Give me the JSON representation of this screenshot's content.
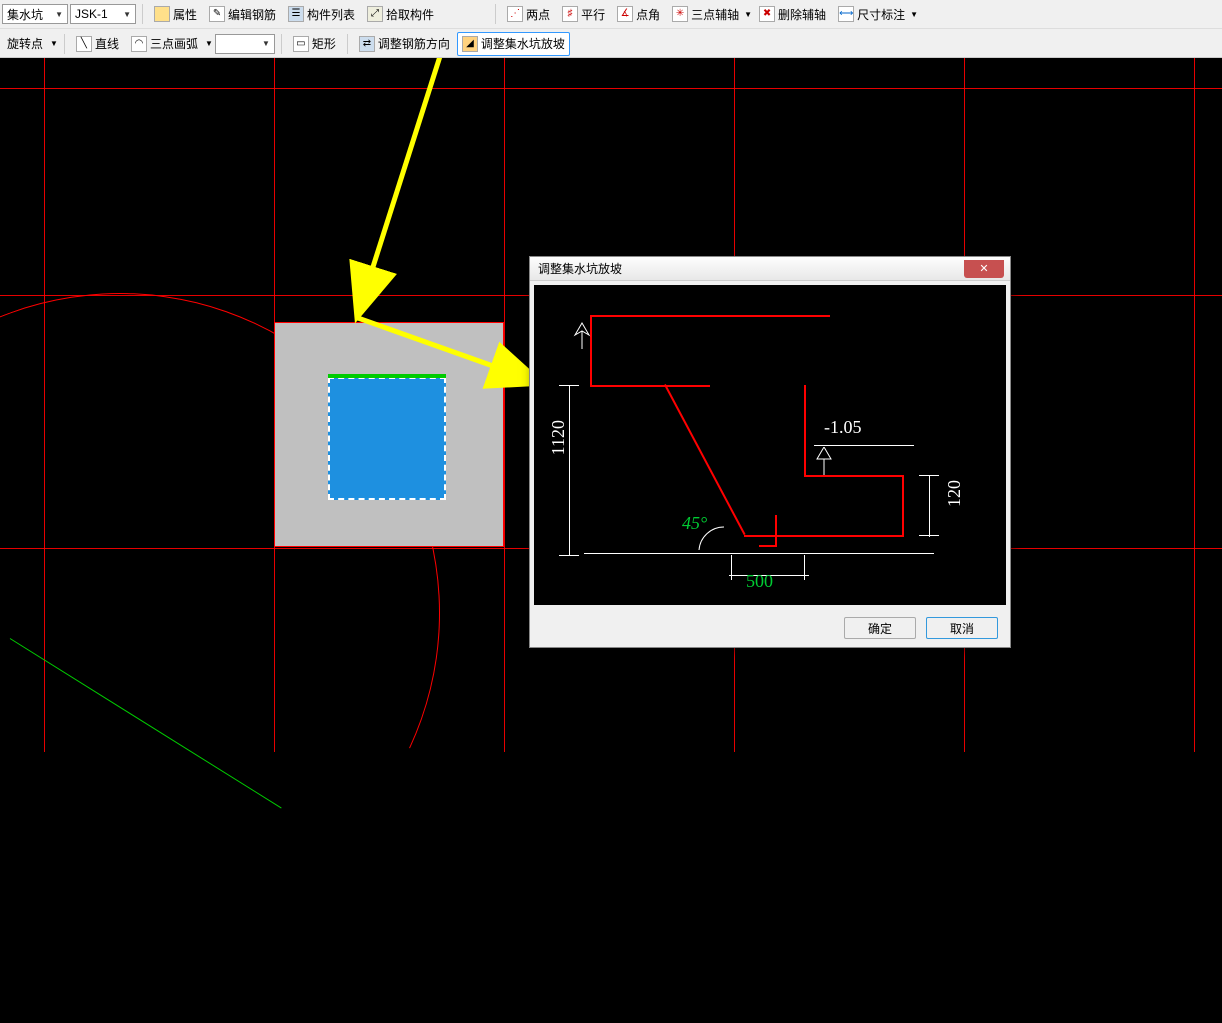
{
  "toolbar": {
    "dropdown1": "集水坑",
    "dropdown2": "JSK-1",
    "attributes": "属性",
    "edit_rebar": "编辑钢筋",
    "component_list": "构件列表",
    "pick_component": "拾取构件",
    "two_point": "两点",
    "parallel": "平行",
    "point_angle": "点角",
    "three_point_axis": "三点辅轴",
    "delete_axis": "删除辅轴",
    "dimension": "尺寸标注",
    "rotate_point": "旋转点",
    "line": "直线",
    "three_point_arc": "三点画弧",
    "rect": "矩形",
    "adjust_rebar_dir": "调整钢筋方向",
    "adjust_sump_slope": "调整集水坑放坡"
  },
  "dialog": {
    "title": "调整集水坑放坡",
    "ok": "确定",
    "cancel": "取消",
    "dim_height": "1120",
    "dim_right": "120",
    "dim_bottom": "500",
    "angle": "45°",
    "elevation": "-1.05"
  }
}
